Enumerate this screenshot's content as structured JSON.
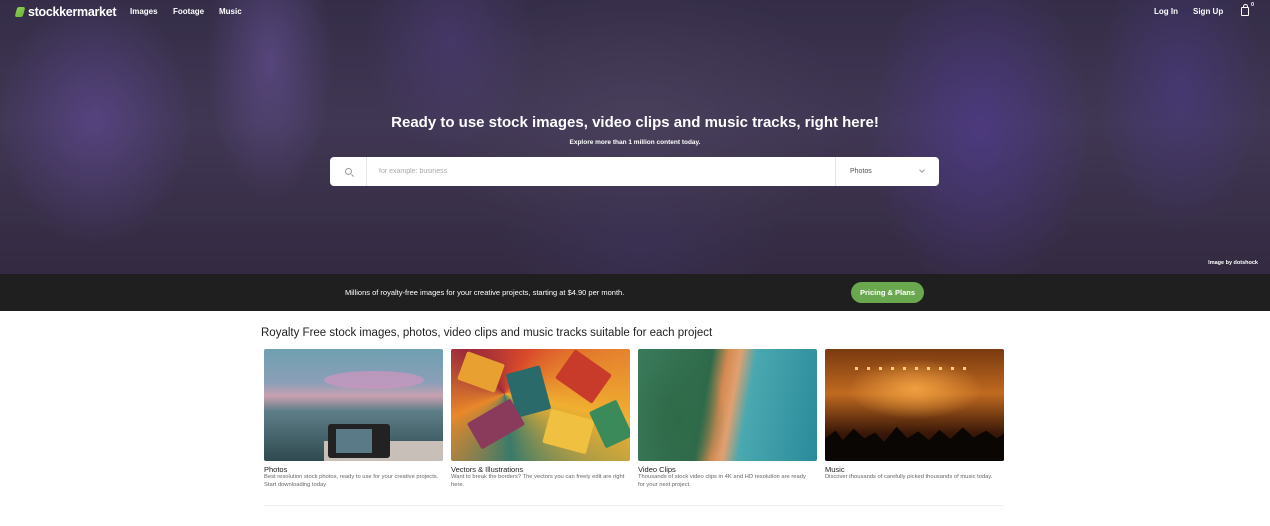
{
  "nav": {
    "brand": "stockkermarket",
    "links": [
      "Images",
      "Footage",
      "Music"
    ],
    "login": "Log In",
    "signup": "Sign Up",
    "cart_count": "0",
    "cart_icon": "shopping-bag-icon"
  },
  "hero": {
    "title": "Ready to use stock images, video clips and music tracks, right here!",
    "subtitle": "Explore more than 1 million content today.",
    "search": {
      "placeholder": "for example: business",
      "value": "",
      "icon": "search-icon"
    },
    "category_select": "Photos",
    "image_credit": "Image by dotshock"
  },
  "band": {
    "text": "Millions of royalty-free images for your creative projects, starting at $4.90 per month.",
    "button": "Pricing & Plans",
    "button_color": "#6aa84f"
  },
  "main": {
    "title": "Royalty Free stock images, photos, video clips and music tracks suitable for each project",
    "cards": [
      {
        "title": "Photos",
        "description": "Best resolution stock photos, ready to use for your creative projects. Start downloading today"
      },
      {
        "title": "Vectors & Illustrations",
        "description": "Want to break the borders? The vectors you can freely edit are right here."
      },
      {
        "title": "Video Clips",
        "description": "Thousands of stock video clips in 4K and HD resolution are ready for your next project."
      },
      {
        "title": "Music",
        "description": "Discover thousands of carefully picked thousands of music today."
      }
    ]
  }
}
